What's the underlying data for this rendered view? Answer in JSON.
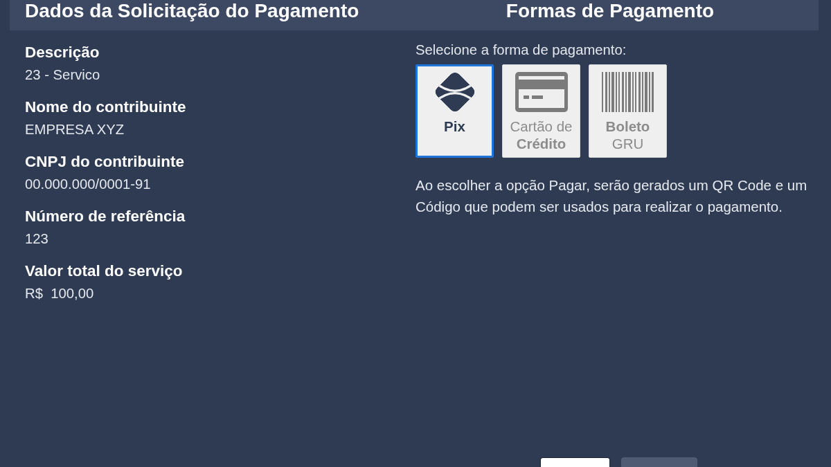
{
  "request": {
    "title": "Dados da Solicitação do Pagamento",
    "fields": [
      {
        "label": "Descrição",
        "value": "23 - Servico"
      },
      {
        "label": "Nome do contribuinte",
        "value": "EMPRESA XYZ"
      },
      {
        "label": "CNPJ do contribuinte",
        "value": "00.000.000/0001-91"
      },
      {
        "label": "Número de referência",
        "value": "123"
      },
      {
        "label": "Valor total do serviço",
        "value": "R$  100,00"
      }
    ]
  },
  "payment": {
    "title": "Formas de Pagamento",
    "prompt": "Selecione a forma de pagamento:",
    "methods": [
      {
        "kind": "pix",
        "selected": true,
        "lines": [
          {
            "text": "Pix",
            "bold": true
          }
        ]
      },
      {
        "kind": "card",
        "selected": false,
        "lines": [
          {
            "text": "Cartão de",
            "bold": false
          },
          {
            "text": "Crédito",
            "bold": true
          }
        ]
      },
      {
        "kind": "boleto",
        "selected": false,
        "lines": [
          {
            "text": "Boleto",
            "bold": true
          },
          {
            "text": "GRU",
            "bold": false
          }
        ]
      }
    ],
    "note": "Ao escolher a opção Pagar, serão gerados um QR Code e um Código que podem ser usados para realizar o pagamento."
  },
  "buttons": [
    {
      "kind": "primary"
    },
    {
      "kind": "secondary"
    }
  ]
}
